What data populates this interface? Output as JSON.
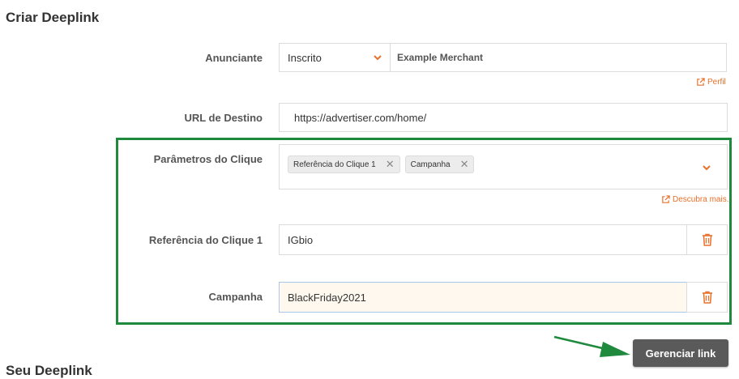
{
  "page": {
    "title": "Criar Deeplink",
    "next_section_title": "Seu Deeplink"
  },
  "advertiser": {
    "label": "Anunciante",
    "filter_value": "Inscrito",
    "merchant_value": "Example Merchant",
    "profile_link": "Perfil"
  },
  "destination": {
    "label": "URL de Destino",
    "value": "https://advertiser.com/home/"
  },
  "click_params": {
    "label": "Parâmetros do Clique",
    "tags": [
      "Referência do Clique 1",
      "Campanha"
    ],
    "discover_link": "Descubra mais."
  },
  "click_ref": {
    "label": "Referência do Clique 1",
    "value": "IGbio"
  },
  "campaign": {
    "label": "Campanha",
    "value": "BlackFriday2021"
  },
  "actions": {
    "manage_link": "Gerenciar link"
  },
  "colors": {
    "accent": "#e8702a",
    "highlight": "#1f8a3d",
    "button": "#5a5a5a"
  }
}
